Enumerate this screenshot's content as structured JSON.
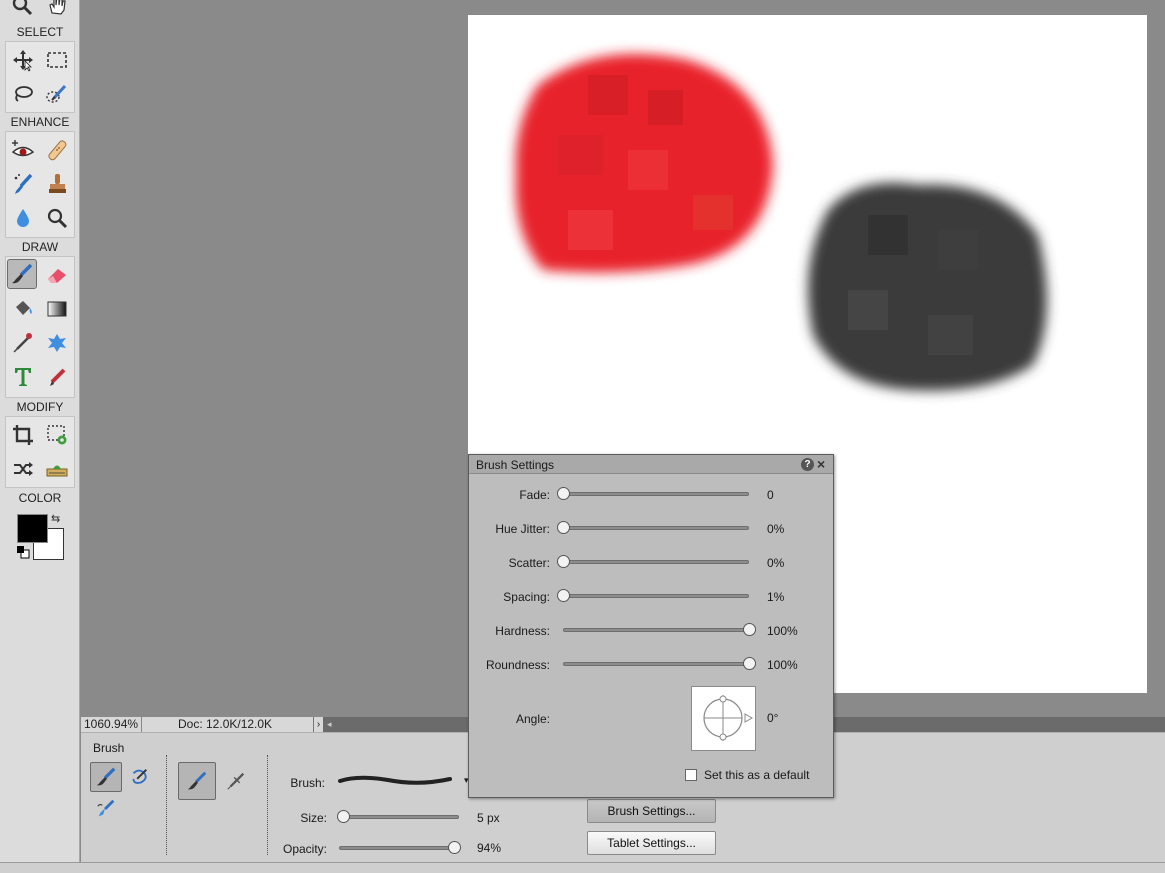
{
  "toolbox": {
    "sections": {
      "select": "SELECT",
      "enhance": "ENHANCE",
      "draw": "DRAW",
      "modify": "MODIFY",
      "color": "COLOR"
    },
    "tools": {
      "view": [
        "zoom-icon",
        "hand-icon"
      ],
      "select": [
        "move-icon",
        "rectangular-marquee-icon",
        "lasso-icon",
        "quick-selection-icon"
      ],
      "enhance": [
        "red-eye-icon",
        "spot-healing-brush-icon",
        "smart-brush-icon",
        "clone-stamp-icon",
        "blur-icon",
        "sponge-icon"
      ],
      "draw": [
        "brush-icon",
        "eraser-icon",
        "paint-bucket-icon",
        "gradient-icon",
        "eyedropper-icon",
        "custom-shape-icon",
        "type-icon",
        "pencil-icon"
      ],
      "modify": [
        "crop-icon",
        "recompose-icon",
        "content-aware-move-icon",
        "straighten-icon"
      ]
    },
    "active_tool": "brush-icon",
    "foreground_color": "#000000",
    "background_color": "#ffffff"
  },
  "statusbar": {
    "zoom": "1060.94%",
    "doc_info": "Doc: 12.0K/12.0K"
  },
  "options_bar": {
    "title": "Brush",
    "brush_label": "Brush:",
    "size_label": "Size:",
    "size_value": "5 px",
    "size_fraction": 0.02,
    "opacity_label": "Opacity:",
    "opacity_value": "94%",
    "opacity_fraction": 0.94,
    "brush_settings_button": "Brush Settings...",
    "tablet_settings_button": "Tablet Settings..."
  },
  "brush_settings_dialog": {
    "title": "Brush Settings",
    "rows": [
      {
        "label": "Fade:",
        "value": "0",
        "fraction": 0
      },
      {
        "label": "Hue Jitter:",
        "value": "0%",
        "fraction": 0
      },
      {
        "label": "Scatter:",
        "value": "0%",
        "fraction": 0
      },
      {
        "label": "Spacing:",
        "value": "1%",
        "fraction": 0
      },
      {
        "label": "Hardness:",
        "value": "100%",
        "fraction": 1
      },
      {
        "label": "Roundness:",
        "value": "100%",
        "fraction": 1
      }
    ],
    "angle_label": "Angle:",
    "angle_value": "0°",
    "default_label": "Set this as a default",
    "default_checked": false
  },
  "colors": {
    "red_blob": "#e8242c",
    "dark_blob": "#3a3a3a"
  }
}
